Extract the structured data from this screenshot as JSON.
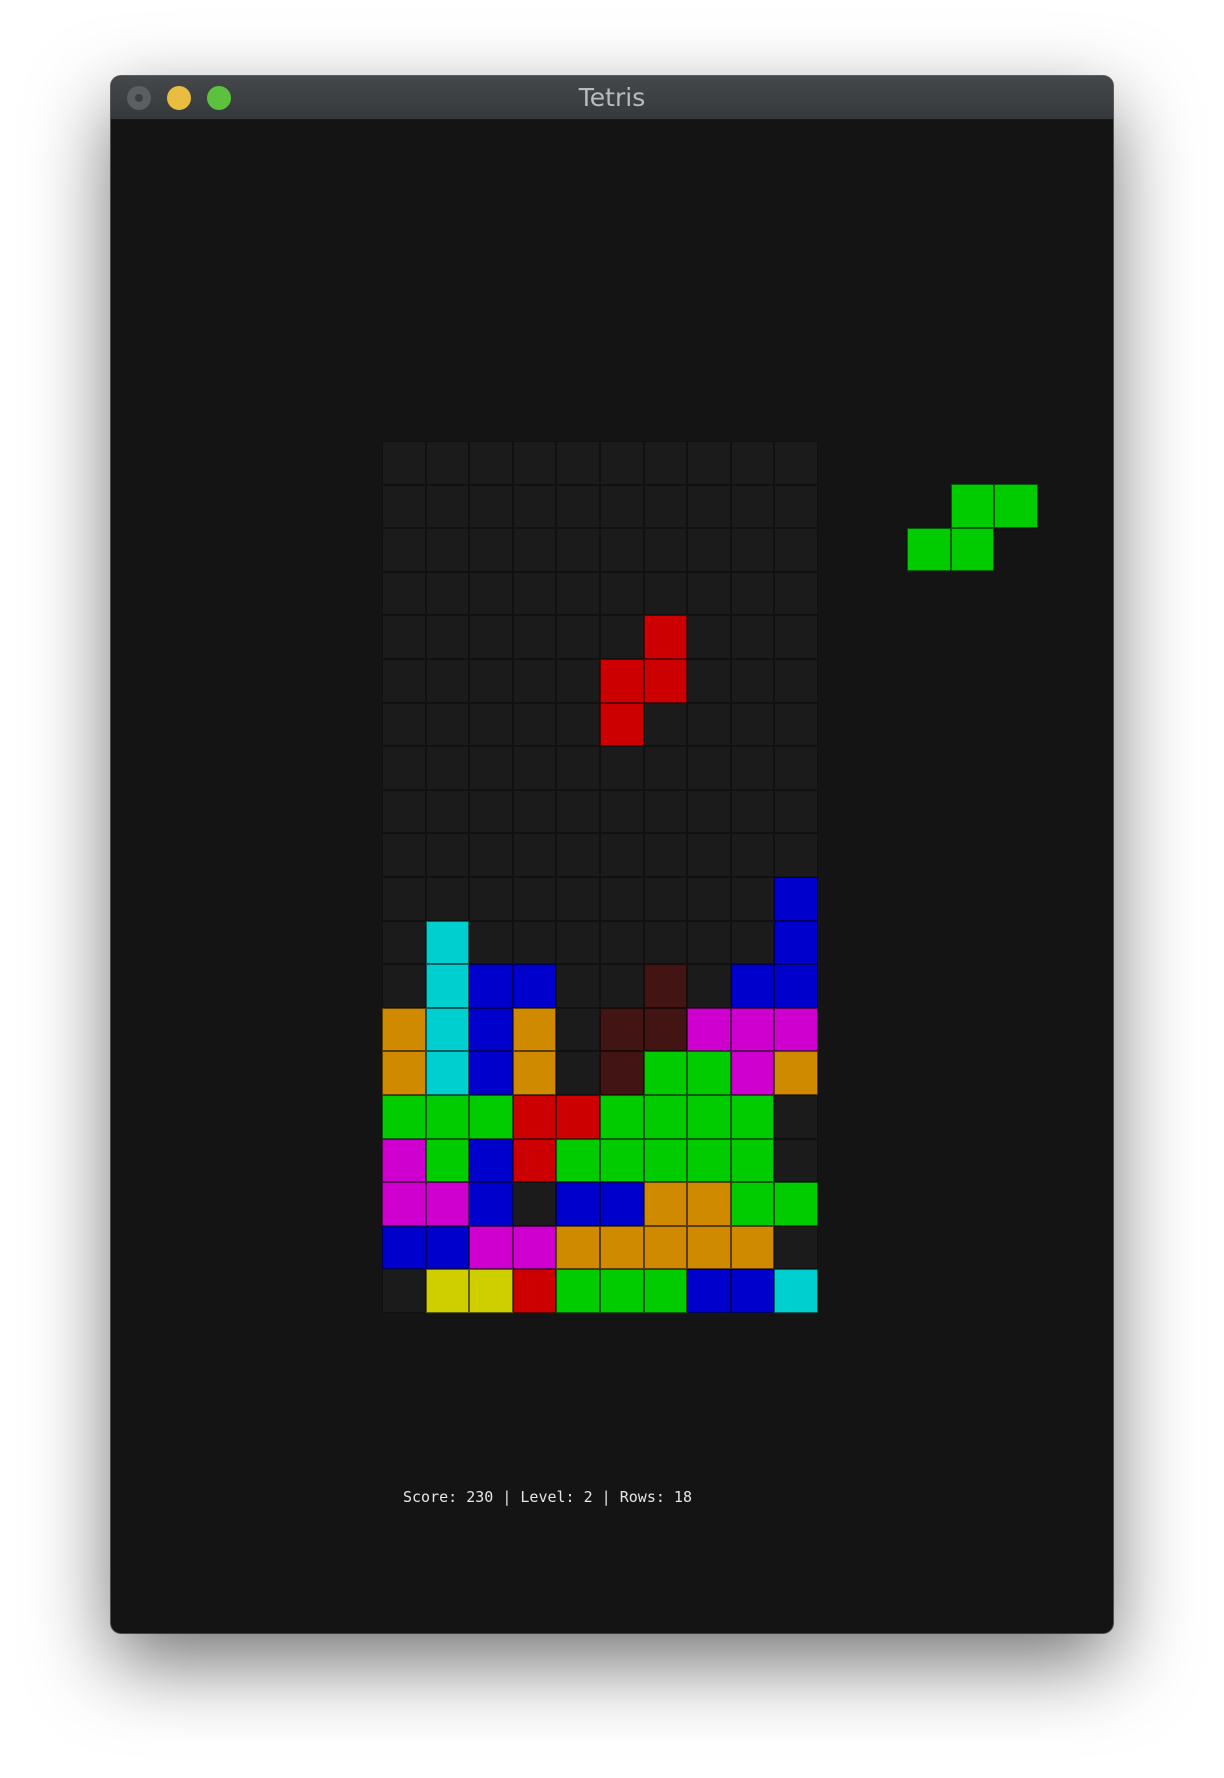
{
  "window": {
    "title": "Tetris"
  },
  "status": {
    "text": "Score: 230 | Level: 2 | Rows: 18"
  },
  "board": {
    "columns": 10,
    "rows": 20,
    "legend": {
      ".": "empty",
      "C": "cyan",
      "B": "blue",
      "O": "orange",
      "Y": "yellow",
      "G": "green",
      "R": "red",
      "M": "magenta",
      "D": "dark-red"
    },
    "colors": {
      ".": "#1b1b1b",
      "C": "#00cfd0",
      "B": "#0000cc",
      "O": "#d08a00",
      "Y": "#cfcf00",
      "G": "#00cc00",
      "R": "#cc0000",
      "M": "#cf00cf",
      "D": "#431414"
    },
    "grid": [
      "..........",
      "..........",
      "..........",
      "..........",
      "......R...",
      ".....RR...",
      ".....R....",
      "..........",
      "..........",
      "..........",
      ".........B",
      ".C.......B",
      ".CBB..D.BB",
      "OCBO.DDMMM",
      "OCBO.DGGMO",
      "GGGRRGGGG.",
      "MGBRGGGGG.",
      "MMB.BBOOGG",
      "BBMMOOOOO.",
      ".YYRGGGBBC"
    ]
  },
  "next_piece": {
    "name": "S",
    "color": "#00cc00",
    "grid": [
      ".GG",
      "GG."
    ]
  }
}
